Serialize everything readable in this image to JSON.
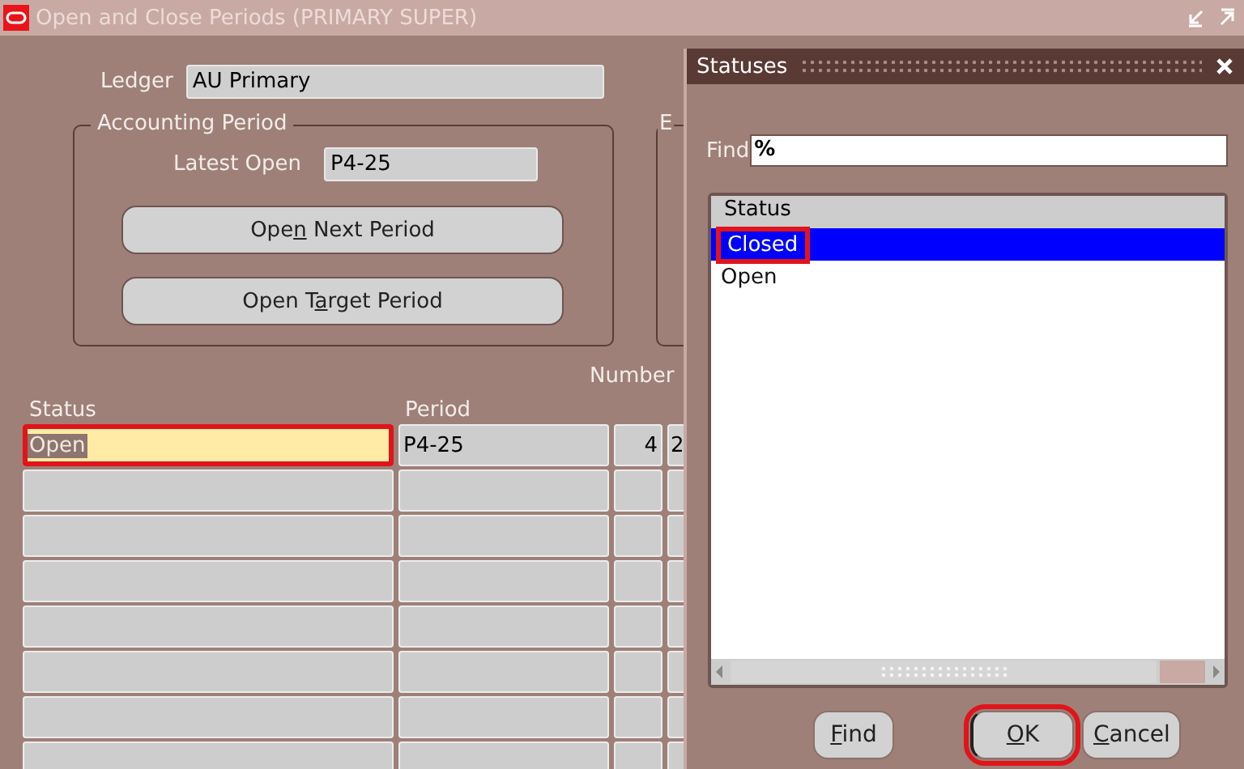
{
  "window": {
    "title": "Open and Close Periods (PRIMARY SUPER)"
  },
  "ledger": {
    "label": "Ledger",
    "value": "AU Primary"
  },
  "accounting_period": {
    "title": "Accounting Period",
    "latest_open_label": "Latest Open",
    "latest_open": "P4-25",
    "buttons": [
      {
        "before": "Ope",
        "key": "n",
        "after": " Next Period"
      },
      {
        "before": "Open T",
        "key": "a",
        "after": "rget Period"
      }
    ]
  },
  "group_2": {
    "title": "E"
  },
  "table": {
    "column_group_label": "Number",
    "columns": [
      "Status",
      "Period"
    ],
    "rows": [
      {
        "cells": [
          "Open",
          "P4-25",
          "4",
          "2"
        ],
        "current": true,
        "highlighted": true
      }
    ]
  },
  "dialog": {
    "title": "Statuses",
    "find_label": "Find",
    "find_value": "%",
    "list": {
      "column": "Status",
      "items": [
        {
          "label": "Closed",
          "selected": true,
          "highlighted": true
        },
        {
          "label": "Open",
          "selected": false,
          "highlighted": false
        }
      ]
    },
    "buttons": [
      {
        "key": "F",
        "after": "ind",
        "focused": false,
        "highlighted": false
      },
      {
        "key": "O",
        "after": "K",
        "focused": true,
        "highlighted": true
      },
      {
        "key": "C",
        "after": "ancel",
        "focused": false,
        "highlighted": false
      }
    ]
  }
}
